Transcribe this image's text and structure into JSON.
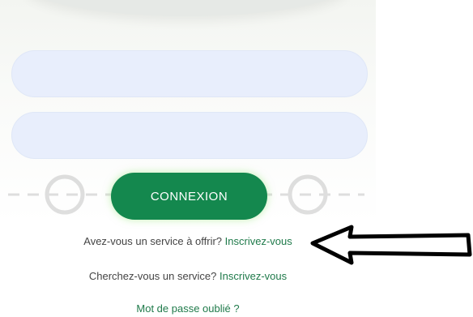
{
  "login": {
    "username": {
      "value": "",
      "placeholder": ""
    },
    "password": {
      "value": "",
      "placeholder": ""
    },
    "submit_label": "CONNEXION"
  },
  "links": {
    "offer_question": "Avez-vous un service à offrir?",
    "offer_link": "Inscrivez-vous",
    "search_question": "Cherchez-vous un service?",
    "search_link": "Inscrivez-vous",
    "forgot_password": "Mot de passe oublié ?"
  },
  "annotation": {
    "arrow_icon": "left-arrow-icon"
  },
  "colors": {
    "primary": "#14884e",
    "link": "#1f7a4a",
    "field_bg": "#e8eefc"
  }
}
